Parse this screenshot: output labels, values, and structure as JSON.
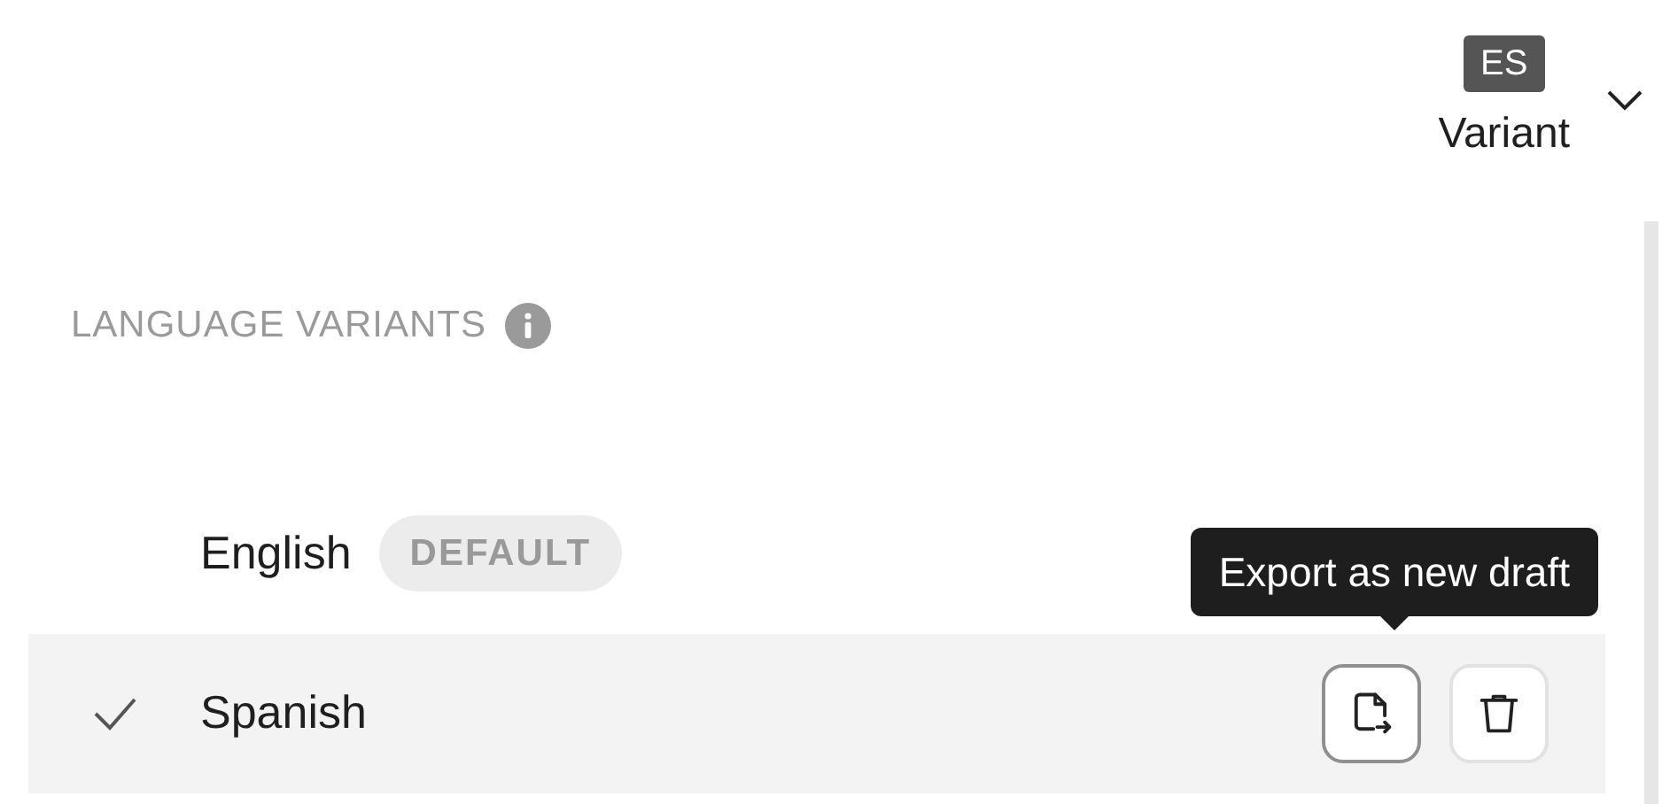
{
  "variant_picker": {
    "flag": "ES",
    "label": "Variant",
    "expanded": false
  },
  "section": {
    "title": "LANGUAGE VARIANTS"
  },
  "variants": [
    {
      "name": "English",
      "badge": "DEFAULT",
      "selected": false
    },
    {
      "name": "Spanish",
      "selected": true,
      "actions": [
        {
          "kind": "export",
          "hovered": true,
          "tooltip": "Export as new draft"
        },
        {
          "kind": "delete",
          "hovered": false
        }
      ]
    }
  ]
}
